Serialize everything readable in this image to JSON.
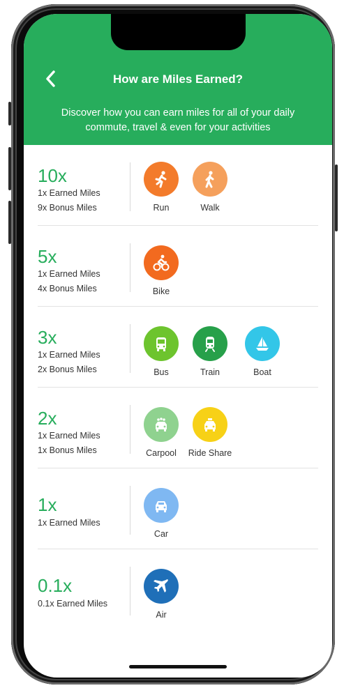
{
  "header": {
    "title": "How are Miles Earned?",
    "subtitle": "Discover how you can earn miles for all of your daily commute, travel & even for your activities",
    "bg_color": "#27ad5c"
  },
  "tiers": [
    {
      "multiplier": "10x",
      "earned": "1x Earned Miles",
      "bonus": "9x Bonus Miles",
      "modes": [
        {
          "label": "Run",
          "icon": "run-icon",
          "color": "#f37b2b"
        },
        {
          "label": "Walk",
          "icon": "walk-icon",
          "color": "#f5a05c"
        }
      ]
    },
    {
      "multiplier": "5x",
      "earned": "1x Earned Miles",
      "bonus": "4x Bonus Miles",
      "modes": [
        {
          "label": "Bike",
          "icon": "bike-icon",
          "color": "#f26a1f"
        }
      ]
    },
    {
      "multiplier": "3x",
      "earned": "1x Earned Miles",
      "bonus": "2x Bonus Miles",
      "modes": [
        {
          "label": "Bus",
          "icon": "bus-icon",
          "color": "#6dc42e"
        },
        {
          "label": "Train",
          "icon": "train-icon",
          "color": "#27a04a"
        },
        {
          "label": "Boat",
          "icon": "boat-icon",
          "color": "#33c6e8"
        }
      ]
    },
    {
      "multiplier": "2x",
      "earned": "1x Earned Miles",
      "bonus": "1x Bonus Miles",
      "modes": [
        {
          "label": "Carpool",
          "icon": "carpool-icon",
          "color": "#8fd28f"
        },
        {
          "label": "Ride Share",
          "icon": "taxi-icon",
          "color": "#f7d117"
        }
      ]
    },
    {
      "multiplier": "1x",
      "earned": "1x Earned Miles",
      "bonus": "",
      "modes": [
        {
          "label": "Car",
          "icon": "car-icon",
          "color": "#7fb8f2"
        }
      ]
    },
    {
      "multiplier": "0.1x",
      "earned": "0.1x Earned Miles",
      "bonus": "",
      "modes": [
        {
          "label": "Air",
          "icon": "airplane-icon",
          "color": "#1f6fb8"
        }
      ]
    }
  ]
}
